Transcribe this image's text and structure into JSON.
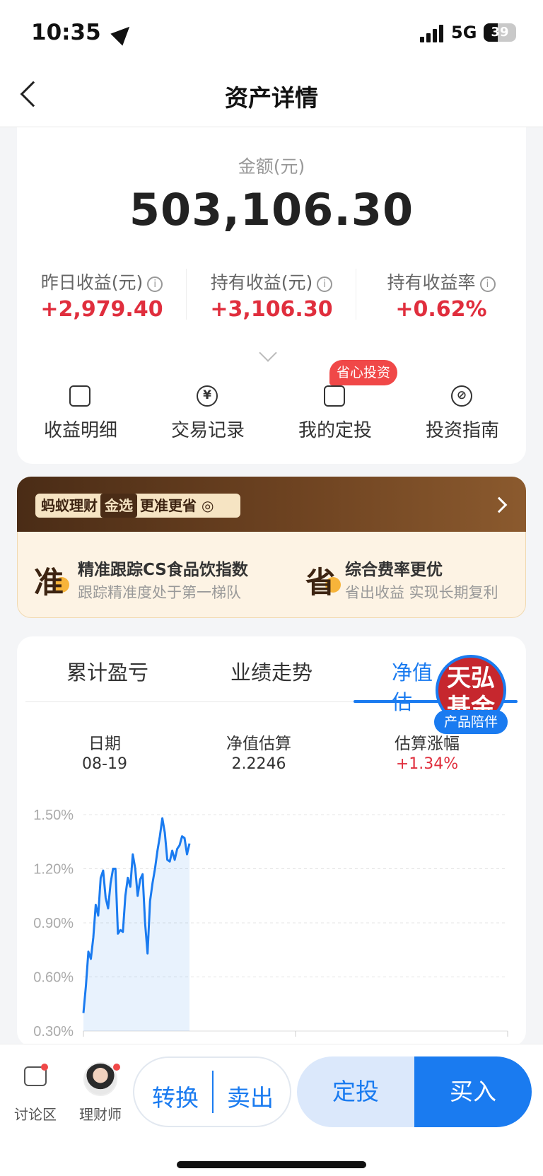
{
  "status_bar": {
    "time": "10:35",
    "network": "5G",
    "battery": "39"
  },
  "nav": {
    "title": "资产详情"
  },
  "asset": {
    "amount_label": "金额(元)",
    "amount": "503,106.30",
    "stats": [
      {
        "label": "昨日收益(元)",
        "value": "+2,979.40"
      },
      {
        "label": "持有收益(元)",
        "value": "+3,106.30"
      },
      {
        "label": "持有收益率",
        "value": "+0.62%"
      }
    ],
    "actions": [
      {
        "label": "收益明细",
        "icon": "document-icon"
      },
      {
        "label": "交易记录",
        "icon": "yuan-icon"
      },
      {
        "label": "我的定投",
        "icon": "calendar-icon"
      },
      {
        "label": "投资指南",
        "icon": "compass-icon"
      }
    ],
    "badge": "省心投资"
  },
  "promo": {
    "brand": "蚂蚁理财",
    "gold": "金选",
    "slogan": "更准更省",
    "features": [
      {
        "big": "准",
        "title": "精准跟踪CS食品饮指数",
        "desc": "跟踪精准度处于第一梯队"
      },
      {
        "big": "省",
        "title": "综合费率更优",
        "desc": "省出收益 实现长期复利"
      }
    ]
  },
  "chart_section": {
    "tabs": [
      "累计盈亏",
      "业绩走势",
      "净值估"
    ],
    "active_tab": 2,
    "logo_text": "天弘基金",
    "logo_tag": "产品陪伴",
    "columns": [
      {
        "label": "日期",
        "value": "08-19"
      },
      {
        "label": "净值估算",
        "value": "2.2246"
      },
      {
        "label": "估算涨幅",
        "value": "+1.34%"
      }
    ]
  },
  "chart_data": {
    "type": "area",
    "y_ticks": [
      "1.50%",
      "1.20%",
      "0.90%",
      "0.60%",
      "0.30%"
    ],
    "ylim": [
      0.3,
      1.5
    ],
    "x_range": [
      0,
      100
    ],
    "grid": true,
    "color": "#1a7bf0",
    "series": [
      {
        "values": [
          0.4,
          0.55,
          0.74,
          0.7,
          0.82,
          1.0,
          0.94,
          1.15,
          1.19,
          1.04,
          0.98,
          1.12,
          1.2,
          1.2,
          0.84,
          0.86,
          0.85,
          1.05,
          1.15,
          1.1,
          1.28,
          1.2,
          1.05,
          1.14,
          1.17,
          0.9,
          0.73,
          1.02,
          1.12,
          1.2,
          1.3,
          1.38,
          1.48,
          1.4,
          1.25,
          1.24,
          1.3,
          1.25,
          1.31,
          1.33,
          1.38,
          1.37,
          1.28,
          1.34
        ]
      }
    ]
  },
  "bottom_bar": {
    "discuss": "讨论区",
    "advisor": "理财师",
    "convert": "转换",
    "sell": "卖出",
    "fixed_invest": "定投",
    "buy": "买入"
  },
  "colors": {
    "accent": "#1a7bf0",
    "gain": "#e02e3d"
  }
}
